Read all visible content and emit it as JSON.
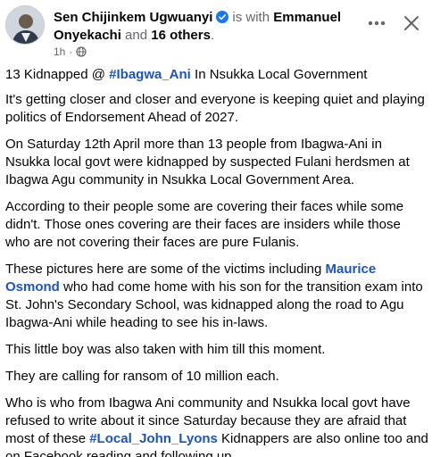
{
  "header": {
    "author": "Sen Chijinkem Ugwuanyi",
    "with_text": "is with",
    "tagged_name": "Emmanuel Onyekachi",
    "and_text": "and",
    "others": "16 others",
    "period": ".",
    "time": "1h",
    "dot": "·",
    "more_label": "•••",
    "close_label": "✕"
  },
  "icons": {
    "verified": "verified-badge-icon",
    "globe": "globe-icon",
    "more": "more-options-icon",
    "close": "close-icon"
  },
  "colors": {
    "link": "#1a55c0",
    "verified": "#1877f2",
    "muted": "#65676b"
  },
  "post": {
    "p1_pre": "13 Kidnapped @ ",
    "p1_tag": "#Ibagwa_Ani",
    "p1_post": " In Nsukka Local Government",
    "p2": "It's getting closer and closer and everyone is keeping quiet and playing politics of Endorsement Ahead of 2027.",
    "p3": "On Saturday 12th April more than  13 people from Ibagwa-Ani in Nsukka local govt were kidnapped by suspected Fulani herdsmen at Ibagwa Agu community in Nsukka Local Government Area.",
    "p4": "According to their people some are covering their faces while some didn't. Those ones covering are their faces are insiders while those who are not covering their faces are pure Fulanis.",
    "p5_pre": "These pictures here are some of the victims including ",
    "p5_mention": "Maurice Osmond",
    "p5_post": " who had come home with his son for the transition exam into St. John's Secondary School, was kidnapped along the road to Agu Ibagwa-Ani while heading to see his in-laws.",
    "p6": "This little boy was also taken with him till this moment.",
    "p7": "They are calling for ransom of 10 million each.",
    "p8_pre": "Who is who from Ibagwa Ani community and Nsukka local govt have refused to write about it since Saturday because they are afraid that most of these ",
    "p8_tag": "#Local_John_Lyons",
    "p8_post": " Kidnappers are also online too and on Facebook reading and following up."
  }
}
